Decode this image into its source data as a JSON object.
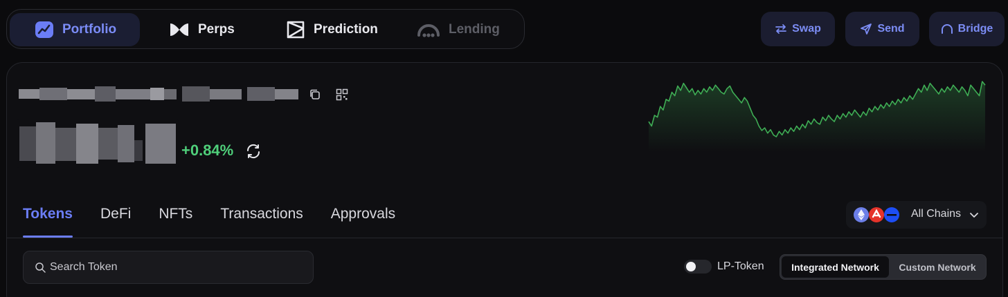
{
  "topnav": {
    "items": [
      {
        "label": "Portfolio",
        "icon": "chart-square-icon",
        "state": "active"
      },
      {
        "label": "Perps",
        "icon": "butterfly-logo-icon",
        "state": "normal"
      },
      {
        "label": "Prediction",
        "icon": "prediction-logo-icon",
        "state": "normal"
      },
      {
        "label": "Lending",
        "icon": "lending-logo-icon",
        "state": "disabled"
      }
    ]
  },
  "actions": {
    "swap_label": "Swap",
    "send_label": "Send",
    "bridge_label": "Bridge"
  },
  "account": {
    "change_percent": "+0.84%"
  },
  "tabs": [
    "Tokens",
    "DeFi",
    "NFTs",
    "Transactions",
    "Approvals"
  ],
  "active_tab": "Tokens",
  "chains": {
    "label": "All Chains",
    "icons": [
      "ethereum-icon",
      "red-chain-icon",
      "blue-chain-icon"
    ]
  },
  "search": {
    "placeholder": "Search Token"
  },
  "lp_token": {
    "label": "LP-Token",
    "enabled": false
  },
  "network_toggle": {
    "options": [
      "Integrated Network",
      "Custom Network"
    ],
    "selected": "Integrated Network"
  },
  "colors": {
    "accent": "#6b7df6",
    "positive": "#4fcf7a",
    "chart_line": "#3fae55"
  },
  "chart_data": {
    "type": "line",
    "values": [
      55,
      50,
      62,
      60,
      72,
      68,
      80,
      78,
      88,
      84,
      95,
      90,
      98,
      93,
      88,
      92,
      85,
      90,
      86,
      92,
      88,
      94,
      90,
      96,
      92,
      88,
      86,
      92,
      95,
      88,
      84,
      80,
      76,
      82,
      78,
      70,
      62,
      58,
      50,
      45,
      48,
      42,
      46,
      40,
      38,
      44,
      40,
      46,
      42,
      48,
      44,
      50,
      46,
      52,
      48,
      56,
      52,
      58,
      54,
      52,
      60,
      56,
      62,
      58,
      55,
      62,
      58,
      64,
      60,
      66,
      62,
      68,
      64,
      60,
      66,
      62,
      70,
      66,
      72,
      68,
      74,
      70,
      76,
      72,
      78,
      74,
      80,
      76,
      82,
      78,
      84,
      80,
      86,
      92,
      88,
      96,
      90,
      98,
      94,
      90,
      86,
      92,
      88,
      94,
      90,
      96,
      92,
      88,
      94,
      90,
      84,
      96,
      92,
      88,
      84,
      100,
      96
    ]
  }
}
